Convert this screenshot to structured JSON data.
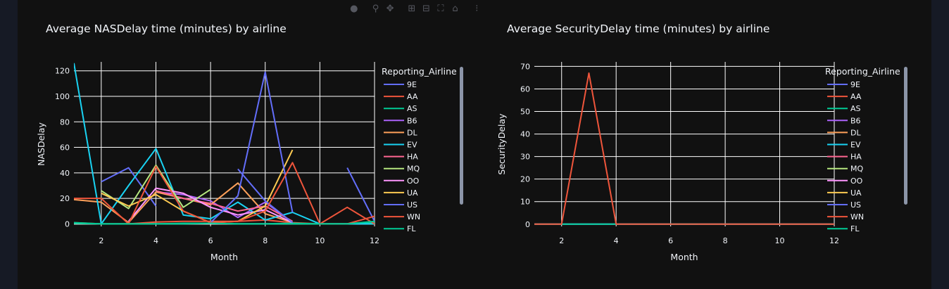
{
  "toolbar": {
    "icons": [
      "camera-icon",
      "zoom-icon",
      "pan-icon",
      "zoom-in-icon",
      "zoom-out-icon",
      "autoscale-icon",
      "home-icon",
      "plotly-logo-icon"
    ]
  },
  "theme": {
    "background": "#111111",
    "page_background": "#161a25",
    "grid": "#ffffff",
    "text": "#f2f5fa"
  },
  "legend_items": [
    {
      "name": "9E",
      "color": "#636efa"
    },
    {
      "name": "AA",
      "color": "#EF553B"
    },
    {
      "name": "AS",
      "color": "#00cc96"
    },
    {
      "name": "B6",
      "color": "#ab63fa"
    },
    {
      "name": "DL",
      "color": "#FFA15A"
    },
    {
      "name": "EV",
      "color": "#19d3f3"
    },
    {
      "name": "HA",
      "color": "#FF6692"
    },
    {
      "name": "MQ",
      "color": "#B6E880"
    },
    {
      "name": "OO",
      "color": "#FF97FF"
    },
    {
      "name": "UA",
      "color": "#FECB52"
    },
    {
      "name": "US",
      "color": "#636efa"
    },
    {
      "name": "WN",
      "color": "#EF553B"
    },
    {
      "name": "FL",
      "color": "#00cc96"
    }
  ],
  "chart_data": [
    {
      "type": "line",
      "title": "Average NASDelay time (minutes) by airline",
      "xlabel": "Month",
      "ylabel": "NASDelay",
      "legend_title": "Reporting_Airline",
      "xlim": [
        1,
        12
      ],
      "ylim": [
        -2,
        127
      ],
      "xticks": [
        2,
        4,
        6,
        8,
        10,
        12
      ],
      "yticks": [
        0,
        20,
        40,
        60,
        80,
        100,
        120
      ],
      "grid": true,
      "legend_position": "right",
      "series": [
        {
          "name": "9E",
          "x": [
            2,
            3,
            4
          ],
          "y": [
            33,
            44,
            14
          ]
        },
        {
          "name": "AA",
          "x": [
            1,
            2,
            3,
            4,
            5,
            6,
            7,
            8,
            9,
            10,
            11,
            12
          ],
          "y": [
            1,
            0,
            0,
            1.5,
            2,
            2,
            2,
            3,
            1,
            0,
            0,
            0.5
          ]
        },
        {
          "name": "AS",
          "x": [
            1,
            2,
            3,
            4,
            5,
            6,
            7,
            8,
            9,
            10,
            11,
            12
          ],
          "y": [
            0.5,
            0,
            0,
            0,
            0.5,
            0.5,
            0,
            0,
            0.5,
            0,
            0,
            1
          ]
        },
        {
          "name": "B6",
          "x": [
            4,
            5,
            6,
            7,
            8,
            9
          ],
          "y": [
            25,
            23,
            18,
            5,
            17,
            1
          ]
        },
        {
          "name": "DL",
          "x": [
            1,
            2,
            3,
            4,
            5,
            6,
            7,
            8,
            9
          ],
          "y": [
            19,
            17,
            1,
            25,
            20,
            15,
            32,
            8,
            1
          ]
        },
        {
          "name": "EV",
          "x": [
            1,
            2,
            3,
            4,
            5,
            6,
            7,
            8,
            9,
            10,
            11,
            12
          ],
          "y": [
            126,
            0,
            30,
            59,
            7,
            4,
            17,
            3,
            9,
            0,
            0,
            0
          ]
        },
        {
          "name": "HA",
          "x": [
            4,
            5,
            6,
            7,
            8,
            9
          ],
          "y": [
            26,
            20,
            16,
            10,
            14,
            2
          ]
        },
        {
          "name": "MQ",
          "x": [
            2,
            3,
            4,
            5,
            6
          ],
          "y": [
            26,
            12,
            46,
            13,
            27
          ]
        },
        {
          "name": "OO",
          "x": [
            3,
            4,
            5,
            6,
            7,
            8,
            9
          ],
          "y": [
            2,
            28,
            24,
            13,
            7,
            11,
            1
          ]
        },
        {
          "name": "UA",
          "x": [
            2,
            3,
            4,
            5,
            6,
            7,
            8,
            9
          ],
          "y": [
            24,
            14,
            23,
            10,
            1,
            2,
            14,
            58
          ]
        },
        {
          "name": "US",
          "x": [
            6,
            7,
            8,
            9
          ],
          "y": [
            1,
            22,
            119,
            9
          ]
        },
        {
          "name": "US",
          "x": [
            7,
            8,
            9
          ],
          "y": [
            43,
            18,
            1
          ]
        },
        {
          "name": "US",
          "x": [
            11,
            12
          ],
          "y": [
            44,
            2
          ]
        },
        {
          "name": "WN",
          "x": [
            1,
            2,
            3,
            4,
            5,
            6,
            7,
            8,
            9,
            10,
            11,
            12
          ],
          "y": [
            20,
            20,
            0,
            45,
            10,
            1,
            2,
            10,
            48,
            0,
            13,
            0
          ]
        },
        {
          "name": "WN",
          "x": [
            10,
            11,
            12
          ],
          "y": [
            0,
            0,
            6
          ]
        },
        {
          "name": "FL",
          "x": [
            1,
            2,
            3,
            4,
            5,
            6,
            7,
            8,
            9,
            10,
            11,
            12
          ],
          "y": [
            1,
            0,
            0,
            0,
            0,
            0.5,
            0,
            0,
            0,
            0,
            0,
            2
          ]
        }
      ]
    },
    {
      "type": "line",
      "title": "Average SecurityDelay time (minutes) by airline",
      "xlabel": "Month",
      "ylabel": "SecurityDelay",
      "legend_title": "Reporting_Airline",
      "xlim": [
        1,
        12
      ],
      "ylim": [
        -1,
        72
      ],
      "xticks": [
        2,
        4,
        6,
        8,
        10,
        12
      ],
      "yticks": [
        0,
        10,
        20,
        30,
        40,
        50,
        60,
        70
      ],
      "grid": true,
      "legend_position": "right",
      "series": [
        {
          "name": "9E",
          "x": [
            1,
            2,
            3,
            4,
            5,
            6,
            7,
            8,
            9,
            10,
            11,
            12
          ],
          "y": [
            0,
            0,
            0,
            0,
            0,
            0,
            0,
            0,
            0,
            0,
            0,
            0
          ]
        },
        {
          "name": "EV",
          "x": [
            6,
            7
          ],
          "y": [
            0,
            0
          ]
        },
        {
          "name": "FL",
          "x": [
            1,
            12
          ],
          "y": [
            0,
            0
          ]
        },
        {
          "name": "AA",
          "x": [
            1,
            2,
            3,
            4,
            5,
            6,
            7,
            8,
            9,
            10,
            11,
            12
          ],
          "y": [
            0,
            0,
            67,
            0,
            0,
            0,
            0,
            0,
            0,
            0,
            0,
            0
          ]
        }
      ]
    }
  ]
}
